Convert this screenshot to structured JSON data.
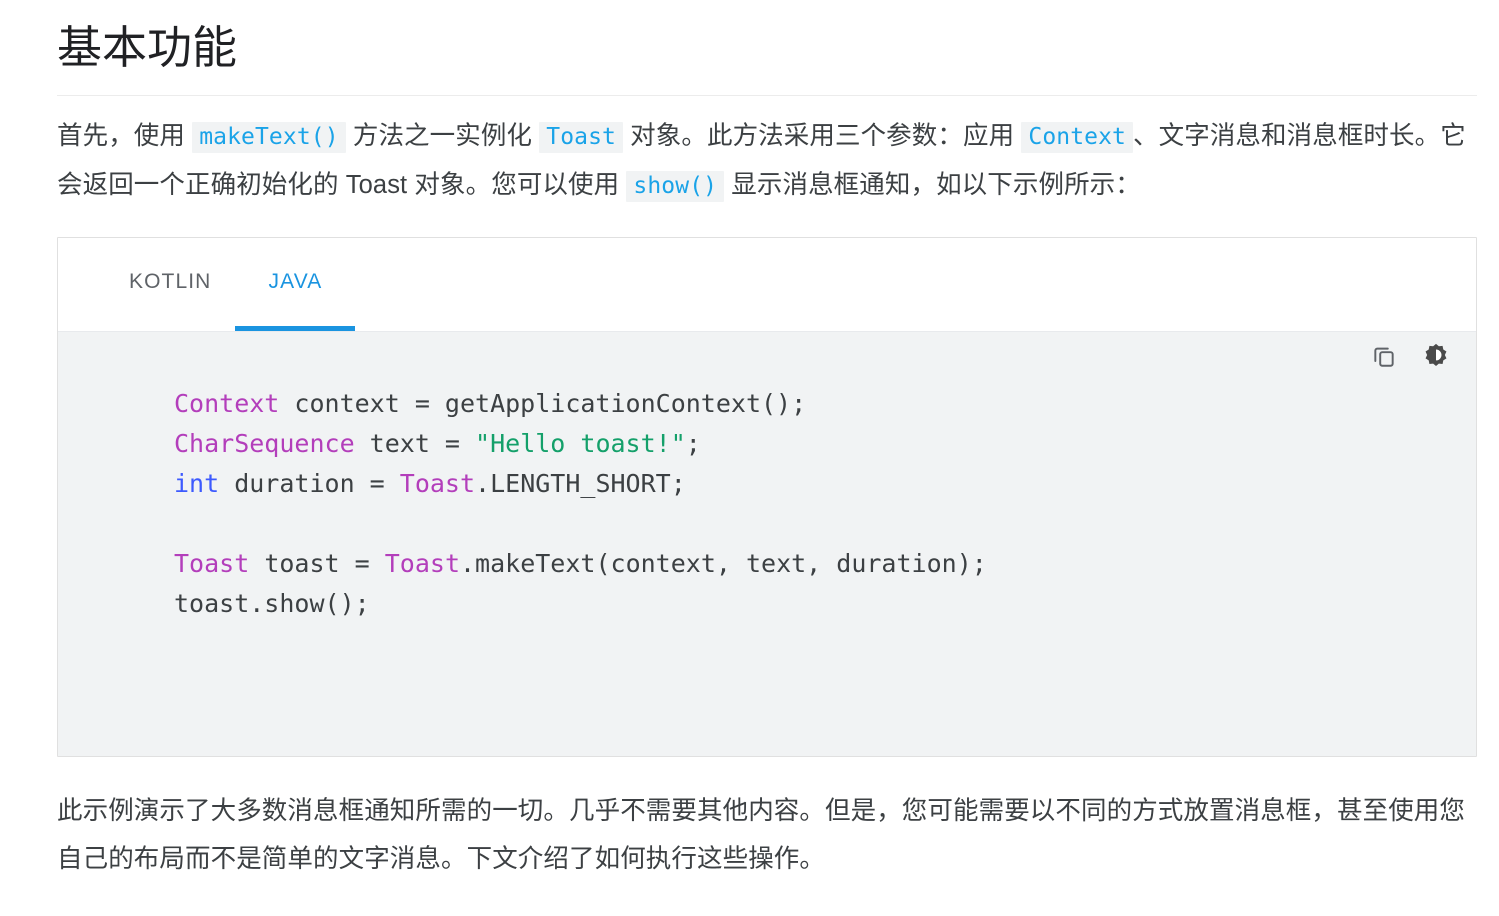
{
  "page": {
    "title": "基本功能"
  },
  "intro_paragraph": {
    "segments": [
      {
        "type": "text",
        "value": "首先，使用 "
      },
      {
        "type": "code",
        "value": "makeText()"
      },
      {
        "type": "text",
        "value": " 方法之一实例化 "
      },
      {
        "type": "code",
        "value": "Toast"
      },
      {
        "type": "text",
        "value": " 对象。此方法采用三个参数：应用 "
      },
      {
        "type": "code",
        "value": "Context"
      },
      {
        "type": "text",
        "value": "、文字消息和消息框时长。它会返回一个正确初始化的 Toast 对象。您可以使用 "
      },
      {
        "type": "code",
        "value": "show()"
      },
      {
        "type": "text",
        "value": " 显示消息框通知，如以下示例所示："
      }
    ],
    "text_1": "首先，使用 ",
    "code_1": "makeText()",
    "text_2": " 方法之一实例化 ",
    "code_2": "Toast",
    "text_3": " 对象。此方法采用三个参数：应用 ",
    "code_3": "Context",
    "text_4": "、文字消息和消息框时长。它会返回一个正确初始化的 Toast 对象。您可以使用 ",
    "code_4": "show()",
    "text_5": " 显示消息框通知，如以下示例所示："
  },
  "code_sample": {
    "tabs": [
      {
        "label": "KOTLIN",
        "active": false
      },
      {
        "label": "JAVA",
        "active": true
      }
    ],
    "tab_kotlin_label": "KOTLIN",
    "tab_java_label": "JAVA",
    "tools": [
      {
        "name": "copy-code-icon",
        "title": "Copy code"
      },
      {
        "name": "toggle-dark-theme-icon",
        "title": "Toggle dark code theme"
      }
    ],
    "language": "java",
    "lines": [
      [
        {
          "t": "type",
          "v": "Context"
        },
        {
          "t": "plain",
          "v": " context = getApplicationContext();"
        }
      ],
      [
        {
          "t": "type",
          "v": "CharSequence"
        },
        {
          "t": "plain",
          "v": " text = "
        },
        {
          "t": "str",
          "v": "\"Hello toast!\""
        },
        {
          "t": "plain",
          "v": ";"
        }
      ],
      [
        {
          "t": "kw",
          "v": "int"
        },
        {
          "t": "plain",
          "v": " duration = "
        },
        {
          "t": "type",
          "v": "Toast"
        },
        {
          "t": "plain",
          "v": ".LENGTH_SHORT;"
        }
      ],
      [],
      [
        {
          "t": "type",
          "v": "Toast"
        },
        {
          "t": "plain",
          "v": " toast = "
        },
        {
          "t": "type",
          "v": "Toast"
        },
        {
          "t": "plain",
          "v": ".makeText(context, text, duration);"
        }
      ],
      [
        {
          "t": "plain",
          "v": "toast.show();"
        }
      ]
    ],
    "plain_text": "Context context = getApplicationContext();\nCharSequence text = \"Hello toast!\";\nint duration = Toast.LENGTH_SHORT;\n\nToast toast = Toast.makeText(context, text, duration);\ntoast.show();"
  },
  "closing_paragraph": {
    "text": "此示例演示了大多数消息框通知所需的一切。几乎不需要其他内容。但是，您可能需要以不同的方式放置消息框，甚至使用您自己的布局而不是简单的文字消息。下文介绍了如何执行这些操作。"
  },
  "colors": {
    "accent_blue": "#1a94e0",
    "inline_code_text": "#1aa3e8",
    "inline_code_bg": "#f1f3f4",
    "code_bg": "#f1f3f4",
    "body_text": "#3c4043",
    "tab_inactive": "#5f6368",
    "syntax_type": "#b33ebb",
    "syntax_keyword": "#3d5afe",
    "syntax_string": "#14a06a",
    "rule": "#ececec"
  }
}
